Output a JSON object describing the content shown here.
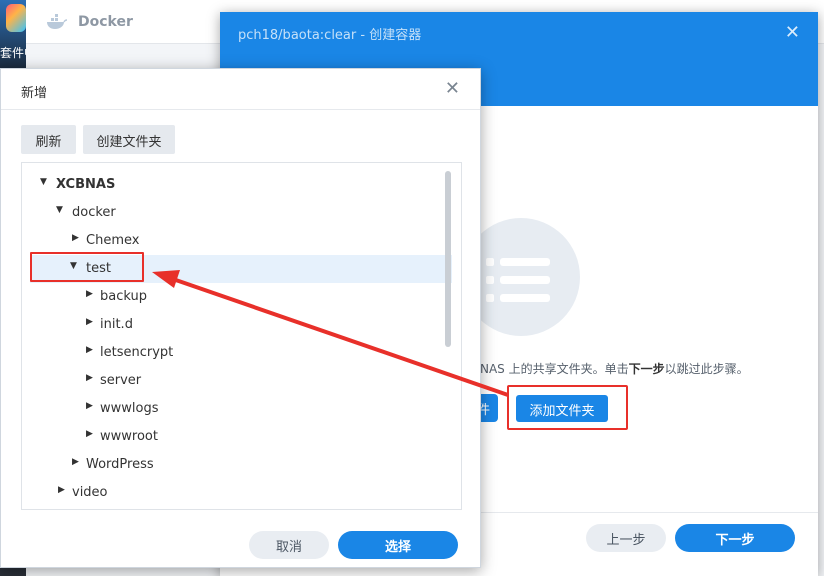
{
  "desktop": {
    "app_label": "套件中"
  },
  "docker": {
    "title": "Docker"
  },
  "wizard": {
    "title": "pch18/baota:clear - 创建容器",
    "hint_prefix": "NAS 上的共享文件夹。单击",
    "hint_bold": "下一步",
    "hint_suffix": "以跳过此步骤。",
    "add_file_label": "件",
    "add_folder_label": "添加文件夹",
    "prev_label": "上一步",
    "next_label": "下一步"
  },
  "dialog": {
    "title": "新增",
    "refresh_label": "刷新",
    "new_folder_label": "创建文件夹",
    "cancel_label": "取消",
    "ok_label": "选择",
    "tree": [
      {
        "label": "XCBNAS",
        "expanded": true
      },
      {
        "label": "docker",
        "expanded": true
      },
      {
        "label": "Chemex",
        "expanded": false
      },
      {
        "label": "test",
        "expanded": true,
        "selected": true
      },
      {
        "label": "backup",
        "expanded": false
      },
      {
        "label": "init.d",
        "expanded": false
      },
      {
        "label": "letsencrypt",
        "expanded": false
      },
      {
        "label": "server",
        "expanded": false
      },
      {
        "label": "wwwlogs",
        "expanded": false
      },
      {
        "label": "wwwroot",
        "expanded": false
      },
      {
        "label": "WordPress",
        "expanded": false
      },
      {
        "label": "video",
        "expanded": false
      }
    ]
  },
  "colors": {
    "accent": "#1a86e6",
    "annotation": "#e8302a"
  }
}
